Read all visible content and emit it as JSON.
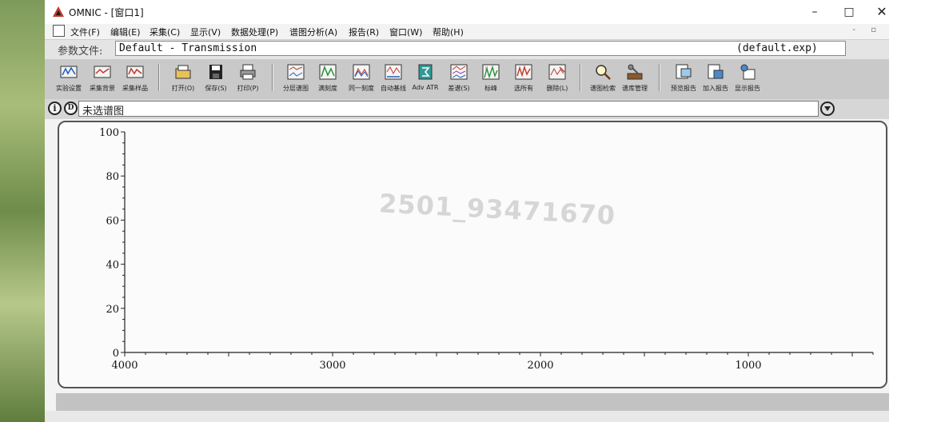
{
  "window": {
    "title": "OMNIC - [窗口1]"
  },
  "menu": [
    "文件(F)",
    "编辑(E)",
    "采集(C)",
    "显示(V)",
    "数据处理(P)",
    "谱图分析(A)",
    "报告(R)",
    "窗口(W)",
    "帮助(H)"
  ],
  "params": {
    "label": "参数文件:",
    "value": "Default - Transmission",
    "file": "(default.exp)"
  },
  "toolbar": {
    "buttons": [
      {
        "label": "实验设置",
        "icon": "experiment-setup-icon"
      },
      {
        "label": "采集背景",
        "icon": "collect-background-icon"
      },
      {
        "label": "采集样品",
        "icon": "collect-sample-icon"
      },
      {
        "label": "打开(O)",
        "icon": "open-icon"
      },
      {
        "label": "保存(S)",
        "icon": "save-icon"
      },
      {
        "label": "打印(P)",
        "icon": "print-icon"
      },
      {
        "label": "分层谱图",
        "icon": "stack-spectra-icon"
      },
      {
        "label": "满刻度",
        "icon": "full-scale-icon"
      },
      {
        "label": "同一刻度",
        "icon": "common-scale-icon"
      },
      {
        "label": "自动基线",
        "icon": "auto-baseline-icon"
      },
      {
        "label": "Adv ATR",
        "icon": "adv-atr-icon"
      },
      {
        "label": "差谱(S)",
        "icon": "subtract-icon"
      },
      {
        "label": "标峰",
        "icon": "find-peaks-icon"
      },
      {
        "label": "选所有",
        "icon": "select-all-icon"
      },
      {
        "label": "删除(L)",
        "icon": "delete-icon"
      },
      {
        "label": "谱图检索",
        "icon": "search-library-icon"
      },
      {
        "label": "谱库管理",
        "icon": "library-manager-icon"
      },
      {
        "label": "预览报告",
        "icon": "preview-report-icon"
      },
      {
        "label": "加入报告",
        "icon": "add-report-icon"
      },
      {
        "label": "显示报告",
        "icon": "show-report-icon"
      }
    ]
  },
  "spectrum_bar": {
    "info_icon": "i",
    "display_icon": "D",
    "selected": "未选谱图"
  },
  "watermark": "2501_93471670",
  "chart_data": {
    "type": "line",
    "title": "",
    "xlabel": "",
    "ylabel": "",
    "xlim": [
      4000,
      400
    ],
    "ylim": [
      0,
      100
    ],
    "x_ticks": [
      4000,
      3000,
      2000,
      1000
    ],
    "y_ticks": [
      100,
      80,
      60,
      40,
      20,
      0
    ],
    "series": []
  },
  "colors": {
    "axis": "#222222",
    "toolbar_bg": "#c9c9c9",
    "plot_bg": "#fbfbfb"
  }
}
